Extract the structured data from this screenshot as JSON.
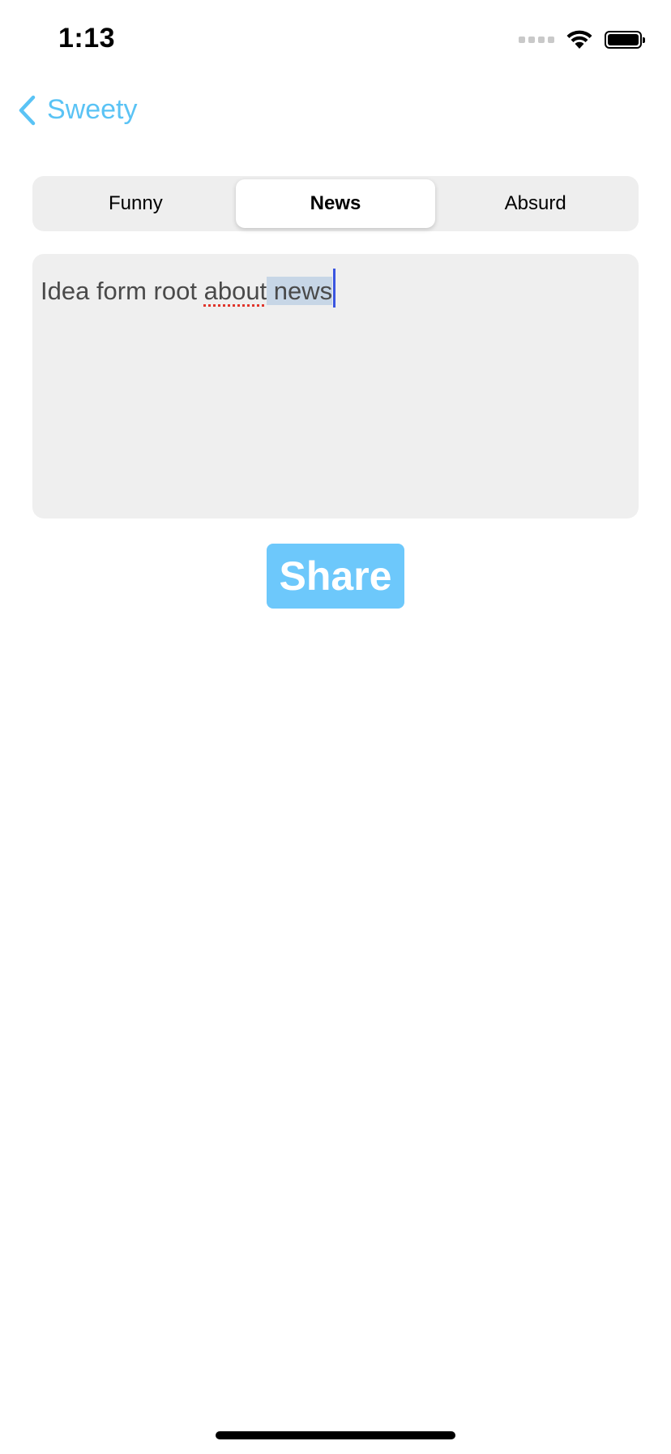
{
  "status_bar": {
    "time": "1:13"
  },
  "nav": {
    "back_label": "Sweety",
    "accent_color": "#5ac3f5"
  },
  "segmented_control": {
    "segments": [
      {
        "label": "Funny",
        "selected": false
      },
      {
        "label": "News",
        "selected": true
      },
      {
        "label": "Absurd",
        "selected": false
      }
    ]
  },
  "editor": {
    "text_part_1": "Idea form root ",
    "misspelled_word": "about",
    "text_part_2": " ",
    "selected_word": "news"
  },
  "share_button": {
    "label": "Share",
    "color": "#6dc8fb"
  },
  "icons": {
    "back": "chevron-left-icon",
    "wifi": "wifi-icon",
    "battery": "battery-icon",
    "signal": "cellular-signal-icon"
  }
}
